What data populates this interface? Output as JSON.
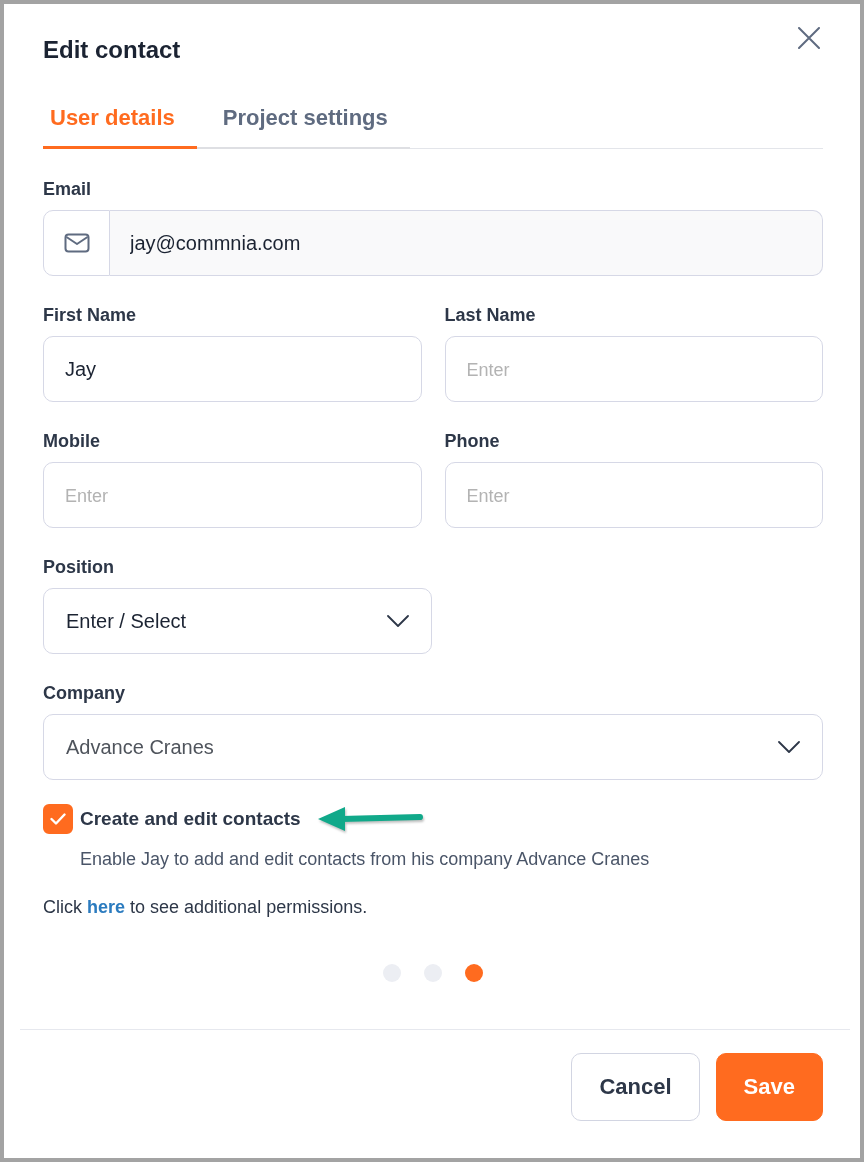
{
  "dialog": {
    "title": "Edit contact"
  },
  "tabs": [
    {
      "label": "User details",
      "selected": true
    },
    {
      "label": "Project settings",
      "selected": false
    }
  ],
  "form_rows": [
    [
      {
        "kind": "email",
        "label": "Email",
        "value": "jay@commnia.com"
      }
    ],
    [
      {
        "kind": "text",
        "label": "First Name",
        "value": "Jay"
      },
      {
        "kind": "text",
        "label": "Last Name",
        "placeholder": "Enter"
      }
    ],
    [
      {
        "kind": "text",
        "label": "Mobile",
        "placeholder": "Enter"
      },
      {
        "kind": "text",
        "label": "Phone",
        "placeholder": "Enter"
      }
    ],
    [
      {
        "kind": "select",
        "label": "Position",
        "placeholder": "Enter / Select"
      }
    ],
    [
      {
        "kind": "select",
        "label": "Company",
        "value": "Advance Cranes"
      }
    ]
  ],
  "permission": {
    "label": "Create and edit contacts",
    "checked": true,
    "description": "Enable Jay to add and edit contacts from his company Advance Cranes"
  },
  "permissions_note": {
    "before": "Click ",
    "link": "here",
    "after": " to see additional permissions."
  },
  "pager": [
    {
      "selected": false
    },
    {
      "selected": false
    },
    {
      "selected": true
    }
  ],
  "buttons": [
    {
      "label": "Cancel",
      "kind": "secondary"
    },
    {
      "label": "Save",
      "kind": "primary"
    }
  ]
}
